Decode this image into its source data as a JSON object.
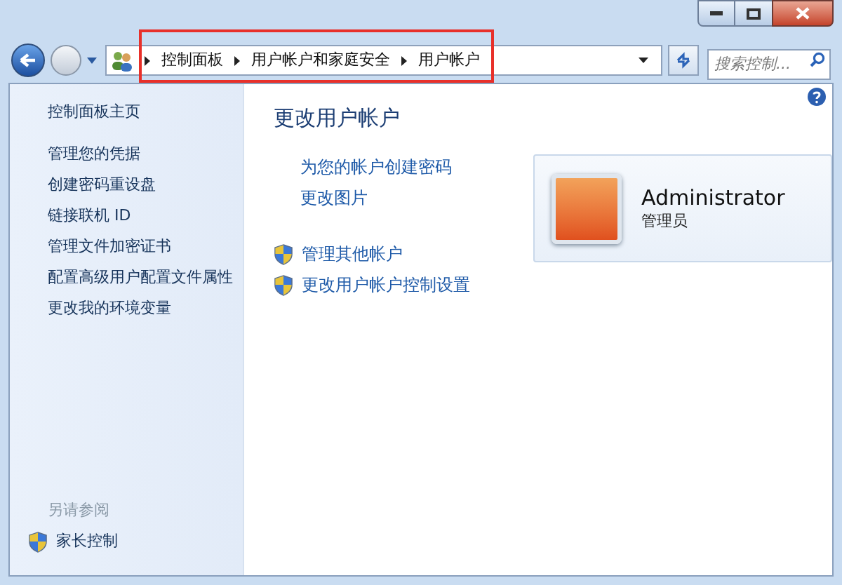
{
  "address_bar": {
    "breadcrumbs": [
      "控制面板",
      "用户帐户和家庭安全",
      "用户帐户"
    ]
  },
  "search": {
    "placeholder": "搜索控制..."
  },
  "sidebar": {
    "home": "控制面板主页",
    "items": [
      {
        "label": "管理您的凭据"
      },
      {
        "label": "创建密码重设盘"
      },
      {
        "label": "链接联机 ID"
      },
      {
        "label": "管理文件加密证书"
      },
      {
        "label": "配置高级用户配置文件属性"
      },
      {
        "label": "更改我的环境变量"
      }
    ],
    "see_also": {
      "title": "另请参阅",
      "items": [
        {
          "label": "家长控制",
          "kind": "shield"
        }
      ]
    }
  },
  "main": {
    "title": "更改用户帐户",
    "links": [
      {
        "label": "为您的帐户创建密码",
        "kind": "plain"
      },
      {
        "label": "更改图片",
        "kind": "plain"
      },
      {
        "label": "管理其他帐户",
        "kind": "shield"
      },
      {
        "label": "更改用户帐户控制设置",
        "kind": "shield"
      }
    ]
  },
  "account": {
    "name": "Administrator",
    "role": "管理员"
  }
}
